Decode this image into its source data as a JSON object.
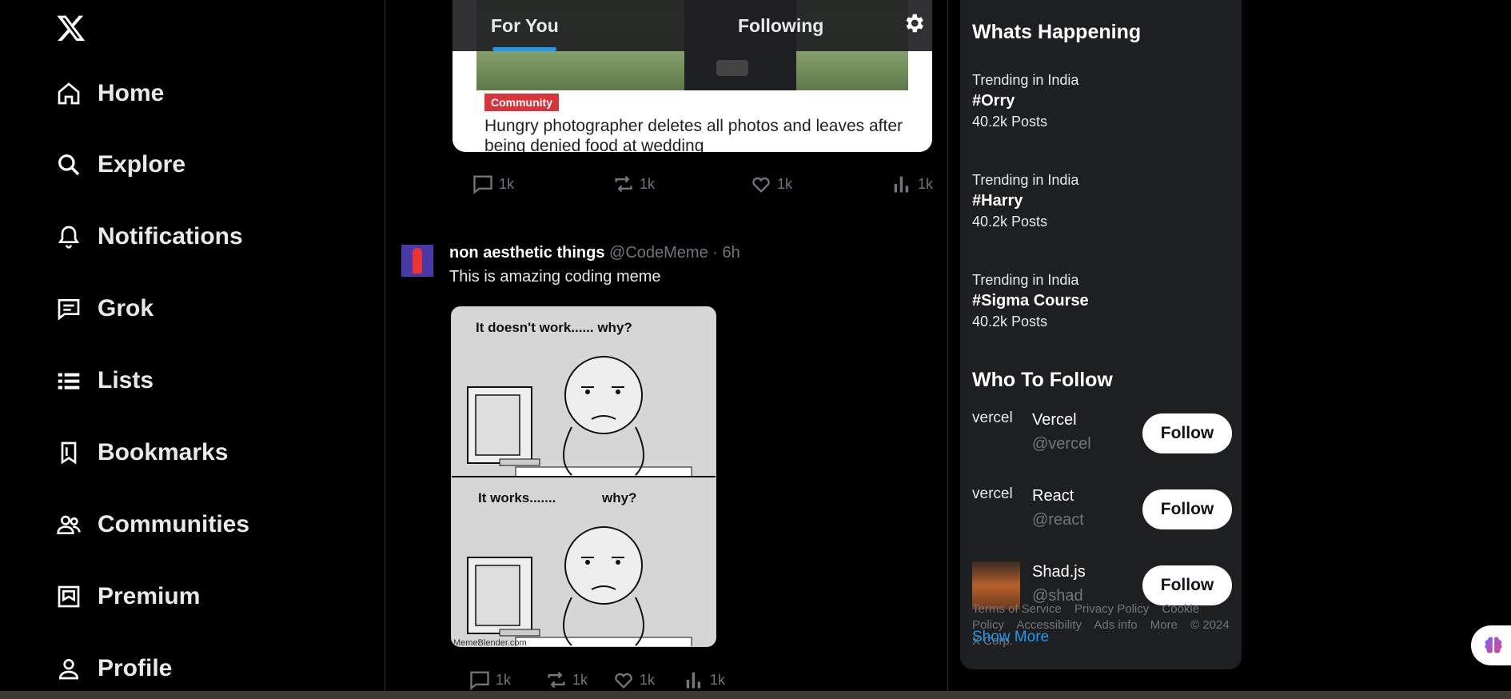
{
  "nav": {
    "logo": "x-logo",
    "items": [
      {
        "label": "Home",
        "icon": "home-icon"
      },
      {
        "label": "Explore",
        "icon": "search-icon"
      },
      {
        "label": "Notifications",
        "icon": "bell-icon"
      },
      {
        "label": "Grok",
        "icon": "message-icon"
      },
      {
        "label": "Lists",
        "icon": "list-icon"
      },
      {
        "label": "Bookmarks",
        "icon": "bookmark-icon"
      },
      {
        "label": "Communities",
        "icon": "people-icon"
      },
      {
        "label": "Premium",
        "icon": "premium-icon"
      },
      {
        "label": "Profile",
        "icon": "person-icon"
      }
    ]
  },
  "tabs": {
    "for_you": "For You",
    "following": "Following",
    "active": "For You"
  },
  "prev_post": {
    "badge": "Community",
    "headline": "Hungry photographer deletes all photos and leaves after being denied food at wedding",
    "replies": "1k",
    "reposts": "1k",
    "likes": "1k",
    "views": "1k"
  },
  "post": {
    "name": "non aesthetic things",
    "handle": "@CodeMeme",
    "time": "· 6h",
    "text": "This is amazing coding meme",
    "meme_caption_top": "It doesn't work...... why?",
    "meme_caption_bottom_1": "It works.......",
    "meme_caption_bottom_2": "why?",
    "meme_footer": "MemeBlender.com",
    "replies": "1k",
    "reposts": "1k",
    "likes": "1k",
    "views": "1k"
  },
  "sidebar": {
    "happening_title": "Whats Happening",
    "trends": [
      {
        "category": "Trending in India",
        "tag": "#Orry",
        "count": "40.2k Posts"
      },
      {
        "category": "Trending in India",
        "tag": "#Harry",
        "count": "40.2k Posts"
      },
      {
        "category": "Trending in India",
        "tag": "#Sigma Course",
        "count": "40.2k Posts"
      }
    ],
    "wtf_title": "Who To Follow",
    "suggestions": [
      {
        "name": "Vercel",
        "handle": "@vercel",
        "avatar_alt": "vercel",
        "follow": "Follow"
      },
      {
        "name": "React",
        "handle": "@react",
        "avatar_alt": "vercel",
        "follow": "Follow"
      },
      {
        "name": "Shad.js",
        "handle": "@shad",
        "avatar_alt": "",
        "follow": "Follow"
      }
    ],
    "footer": {
      "terms": "Terms of Service",
      "privacy": "Privacy Policy",
      "cookie": "Cookie Policy",
      "accessibility": "Accessibility",
      "ads": "Ads info",
      "more": "More",
      "copyright": "© 2024 X Corp."
    },
    "show_more": "Show More"
  },
  "colors": {
    "accent": "#1d9bf0",
    "background": "#000000",
    "sidebar_bg": "#1e1f21",
    "muted": "#71767b"
  }
}
